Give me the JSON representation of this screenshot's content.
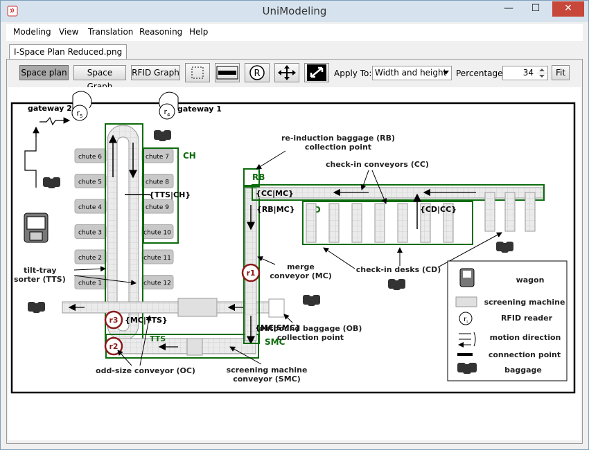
{
  "window": {
    "title": "UniModeling",
    "minimize": "—",
    "maximize": "☐",
    "close": "✕"
  },
  "menu": [
    "Modeling",
    "View",
    "Translation",
    "Reasoning",
    "Help"
  ],
  "tab": {
    "label": "I-Space Plan Reduced.png"
  },
  "toolbar": {
    "space_plan": "Space plan",
    "space_graph": "Space Graph",
    "rfid_graph": "RFID Graph",
    "apply_to_label": "Apply To:",
    "apply_to_value": "Width and height",
    "percentage_label": "Percentage:",
    "percentage_value": "34",
    "fit": "Fit"
  },
  "plan": {
    "gateways": [
      "gateway 2",
      "gateway 1"
    ],
    "reader_subscripts": [
      "5",
      "4"
    ],
    "chutes_left": [
      "chute 6",
      "chute 5",
      "chute 4",
      "chute 3",
      "chute 2",
      "chute 1"
    ],
    "chutes_right": [
      "chute 7",
      "chute 8",
      "chute 9",
      "chute 10",
      "chute 11",
      "chute 12"
    ],
    "zones": {
      "ch": "CH",
      "rb": "RB",
      "cd": "CD",
      "tts": "TTS",
      "smc": "SMC"
    },
    "connections": {
      "tts_ch": "{TTS|CH}",
      "cc_mc": "{CC|MC}",
      "rb_mc": "{RB|MC}",
      "cd_cc": "{CD|CC}",
      "mc_tts": "{MC|TTS}",
      "mc_smc": "{MC|SMC}"
    },
    "readers": [
      "r1",
      "r2",
      "r3"
    ],
    "annotations": {
      "rb_line1": "re-induction baggage (RB)",
      "rb_line2": "collection point",
      "cc": "check-in conveyors (CC)",
      "tts_line1": "tilt-tray",
      "tts_line2": "sorter (TTS)",
      "mc_line1": "merge",
      "mc_line2": "conveyor (MC)",
      "cd": "check-in desks (CD)",
      "ob_line1": "outbound baggage (OB)",
      "ob_line2": "collection point",
      "oc": "odd-size conveyor (OC)",
      "smc_line1": "screening machine",
      "smc_line2": "conveyor (SMC)"
    },
    "legend": [
      "wagon",
      "screening machine",
      "RFID reader",
      "motion direction",
      "connection point",
      "baggage"
    ],
    "legend_reader_sub": "i",
    "colors": {
      "zone": "#0c6b0c",
      "reader": "#8b1a1a",
      "chute": "#c8c8c8",
      "conveyor": "#e6e6e6"
    }
  }
}
